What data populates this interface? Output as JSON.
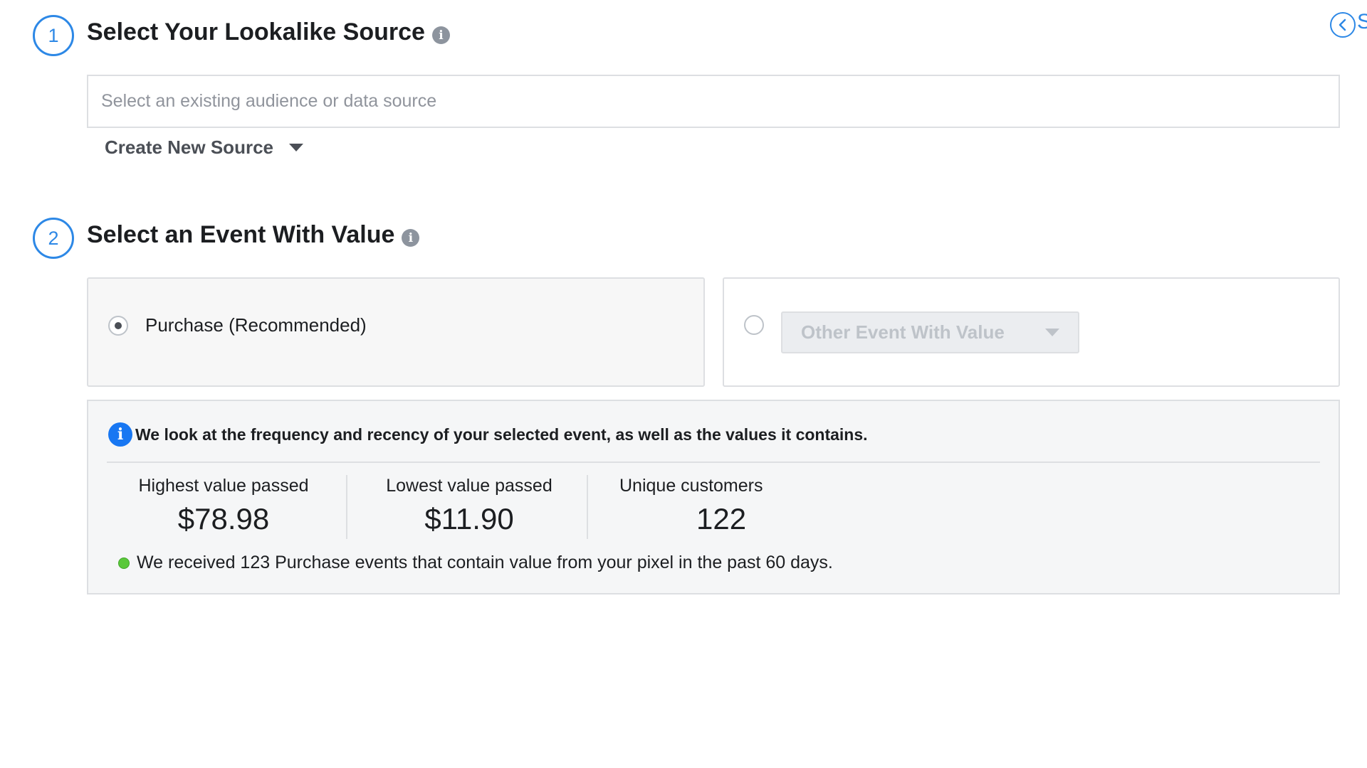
{
  "header": {
    "back_icon": "chevron-left-circle-icon",
    "back_label": "S"
  },
  "step1": {
    "number": "1",
    "title": "Select Your Lookalike Source",
    "info_icon": "i",
    "source_placeholder": "Select an existing audience or data source",
    "create_label": "Create New Source"
  },
  "step2": {
    "number": "2",
    "title": "Select an Event With Value",
    "info_icon": "i",
    "purchase_label": "Purchase (Recommended)",
    "purchase_selected": true,
    "other_label": "Other Event With Value"
  },
  "stats": {
    "notice_icon": "i",
    "notice": "We look at the frequency and recency of your selected event, as well as the values it contains.",
    "highest_label": "Highest value passed",
    "highest_value": "$78.98",
    "lowest_label": "Lowest value passed",
    "lowest_value": "$11.90",
    "customers_label": "Unique customers",
    "customers_value": "122",
    "footnote": "We received 123 Purchase events that contain value from your pixel in the past 60 days."
  },
  "colors": {
    "accent": "#2d88e6",
    "info_blue": "#1877f2",
    "status_green": "#5ac83a"
  }
}
